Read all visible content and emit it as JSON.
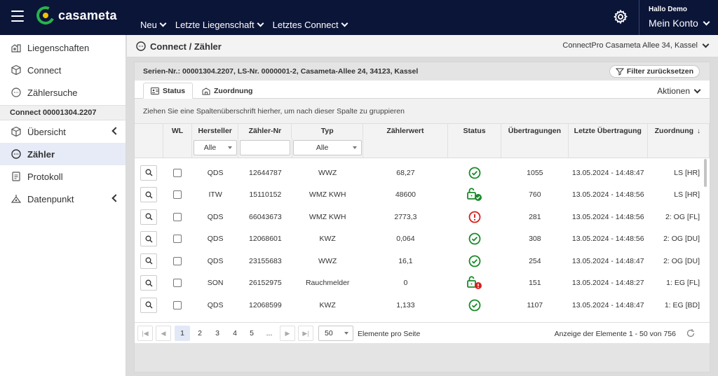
{
  "app": {
    "logo_text": "casameta",
    "nav": [
      {
        "label": "Neu"
      },
      {
        "label": "Letzte Liegenschaft"
      },
      {
        "label": "Letztes Connect"
      }
    ],
    "account_hello": "Hallo Demo",
    "account_label": "Mein Konto",
    "brand_color": "#0b1538",
    "logo_green": "#27b34b",
    "logo_yellow": "#f2c200"
  },
  "sidebar": {
    "items_top": [
      {
        "label": "Liegenschaften",
        "icon": "building-icon"
      },
      {
        "label": "Connect",
        "icon": "box-icon"
      },
      {
        "label": "Zählersuche",
        "icon": "meter-icon"
      }
    ],
    "section_title": "Connect 00001304.2207",
    "items_sub": [
      {
        "label": "Übersicht",
        "icon": "box-icon"
      },
      {
        "label": "Zähler",
        "icon": "meter-icon"
      },
      {
        "label": "Protokoll",
        "icon": "protocol-icon"
      },
      {
        "label": "Datenpunkt",
        "icon": "datapoint-icon"
      }
    ]
  },
  "page": {
    "title": "Connect / Zähler",
    "location": "ConnectPro Casameta Allee 34, Kassel"
  },
  "panel": {
    "info": "Serien-Nr.: 00001304.2207, LS-Nr. 0000001-2, Casameta-Allee 24, 34123, Kassel",
    "filter_reset": "Filter zurücksetzen",
    "tabs": [
      {
        "label": "Status"
      },
      {
        "label": "Zuordnung"
      }
    ],
    "actions_label": "Aktionen",
    "group_hint": "Ziehen Sie eine Spaltenüberschrift hierher, um nach dieser Spalte zu gruppieren"
  },
  "table": {
    "columns": [
      "",
      "WL",
      "Hersteller",
      "Zähler-Nr",
      "Typ",
      "Zählerwert",
      "Status",
      "Übertragungen",
      "Letzte Übertragung",
      "Zuordnung"
    ],
    "filters": {
      "hersteller": "Alle",
      "zaehler_nr": "",
      "typ": "Alle"
    },
    "rows": [
      {
        "hersteller": "QDS",
        "nr": "12644787",
        "typ": "WWZ",
        "wert": "68,27",
        "status": "ok",
        "uebertragungen": "1055",
        "letzte": "13.05.2024 - 14:48:47",
        "zuordnung": "LS [HR]"
      },
      {
        "hersteller": "ITW",
        "nr": "15110152",
        "typ": "WMZ KWH",
        "wert": "48600",
        "status": "unlocked-ok",
        "uebertragungen": "760",
        "letzte": "13.05.2024 - 14:48:56",
        "zuordnung": "LS [HR]"
      },
      {
        "hersteller": "QDS",
        "nr": "66043673",
        "typ": "WMZ KWH",
        "wert": "2773,3",
        "status": "error",
        "uebertragungen": "281",
        "letzte": "13.05.2024 - 14:48:56",
        "zuordnung": "2: OG [FL]"
      },
      {
        "hersteller": "QDS",
        "nr": "12068601",
        "typ": "KWZ",
        "wert": "0,064",
        "status": "ok",
        "uebertragungen": "308",
        "letzte": "13.05.2024 - 14:48:56",
        "zuordnung": "2: OG [DU]"
      },
      {
        "hersteller": "QDS",
        "nr": "23155683",
        "typ": "WWZ",
        "wert": "16,1",
        "status": "ok",
        "uebertragungen": "254",
        "letzte": "13.05.2024 - 14:48:47",
        "zuordnung": "2: OG [DU]"
      },
      {
        "hersteller": "SON",
        "nr": "26152975",
        "typ": "Rauchmelder",
        "wert": "0",
        "status": "unlocked-error",
        "uebertragungen": "151",
        "letzte": "13.05.2024 - 14:48:27",
        "zuordnung": "1: EG [FL]"
      },
      {
        "hersteller": "QDS",
        "nr": "12068599",
        "typ": "KWZ",
        "wert": "1,133",
        "status": "ok",
        "uebertragungen": "1107",
        "letzte": "13.05.2024 - 14:48:47",
        "zuordnung": "1: EG [BD]"
      }
    ]
  },
  "pager": {
    "pages": [
      "1",
      "2",
      "3",
      "4",
      "5",
      "..."
    ],
    "page_size": "50",
    "page_size_label": "Elemente pro Seite",
    "info": "Anzeige der Elemente 1 - 50 von 756"
  },
  "colors": {
    "ok": "#1a8a2a",
    "error": "#d62020",
    "active_bg": "#e6ebf7"
  }
}
